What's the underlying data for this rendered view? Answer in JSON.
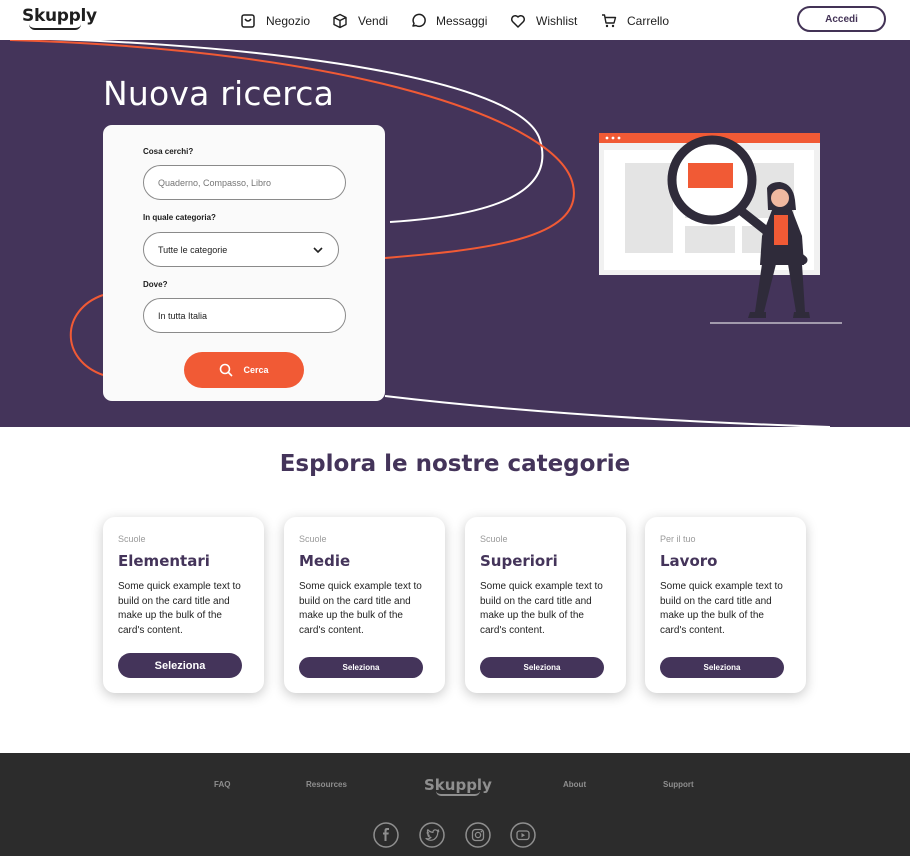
{
  "navbar": {
    "logo": "Skupply",
    "items": [
      {
        "label": "Negozio",
        "icon": "shop-bag-icon"
      },
      {
        "label": "Vendi",
        "icon": "box-icon"
      },
      {
        "label": "Messaggi",
        "icon": "message-bubble-icon"
      },
      {
        "label": "Wishlist",
        "icon": "heart-icon"
      },
      {
        "label": "Carrello",
        "icon": "cart-icon"
      }
    ],
    "login_label": "Accedi"
  },
  "hero": {
    "title": "Nuova ricerca",
    "search_form": {
      "what_label": "Cosa cerchi?",
      "what_placeholder": "Quaderno, Compasso, Libro",
      "category_label": "In quale categoria?",
      "category_value": "Tutte le categorie",
      "where_label": "Dove?",
      "where_value": "In tutta Italia",
      "search_button": "Cerca"
    }
  },
  "categories": {
    "title": "Esplora le nostre categorie",
    "cards": [
      {
        "subtitle": "Scuole",
        "title": "Elementari",
        "text": "Some quick example text to build on the card title and make up the bulk of the card's content.",
        "button": "Seleziona"
      },
      {
        "subtitle": "Scuole",
        "title": "Medie",
        "text": "Some quick example text to build on the card title and make up the bulk of the card's content.",
        "button": "Seleziona"
      },
      {
        "subtitle": "Scuole",
        "title": "Superiori",
        "text": "Some quick example text to build on the card title and make up the bulk of the card's content.",
        "button": "Seleziona"
      },
      {
        "subtitle": "Per il tuo",
        "title": "Lavoro",
        "text": "Some quick example text to build on the card title and make up the bulk of the card's content.",
        "button": "Seleziona"
      }
    ]
  },
  "footer": {
    "links": [
      "FAQ",
      "Resources",
      "About",
      "Support"
    ],
    "logo": "Skupply",
    "social": [
      "facebook-icon",
      "twitter-icon",
      "instagram-icon",
      "youtube-icon"
    ]
  },
  "colors": {
    "primary": "#44345a",
    "accent": "#f15a35",
    "footer_bg": "#2c2c2c"
  }
}
